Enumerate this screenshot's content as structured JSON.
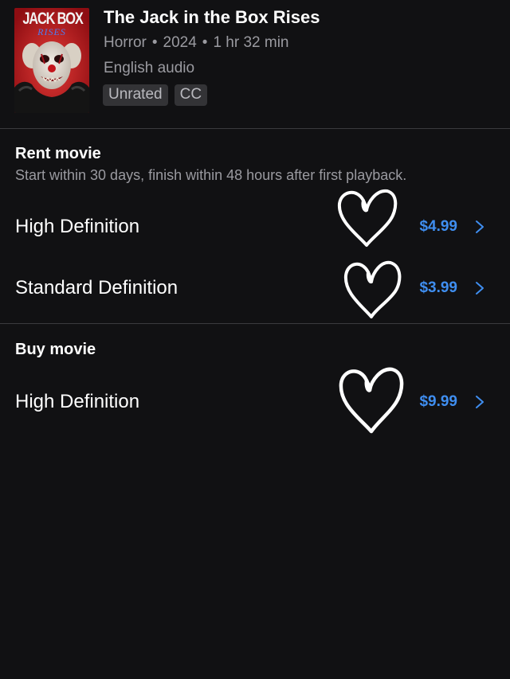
{
  "movie": {
    "title": "The Jack in the Box Rises",
    "genre": "Horror",
    "year": "2024",
    "duration": "1 hr 32 min",
    "separator": "•",
    "audio": "English audio",
    "badges": [
      "Unrated",
      "CC"
    ],
    "poster": {
      "title_text": "JACK BOX",
      "subtitle_text": "RISES"
    }
  },
  "rent": {
    "title": "Rent movie",
    "subtitle": "Start within 30 days, finish within 48 hours after first playback.",
    "options": [
      {
        "label": "High Definition",
        "price": "$4.99"
      },
      {
        "label": "Standard Definition",
        "price": "$3.99"
      }
    ]
  },
  "buy": {
    "title": "Buy movie",
    "options": [
      {
        "label": "High Definition",
        "price": "$9.99"
      }
    ]
  },
  "icons": {
    "chevron": "chevron-right-icon",
    "heart": "heart-doodle-icon"
  },
  "colors": {
    "background": "#111113",
    "price_accent": "#3f8ef0",
    "secondary_text": "#9a9aa0",
    "badge_bg": "#333336"
  }
}
